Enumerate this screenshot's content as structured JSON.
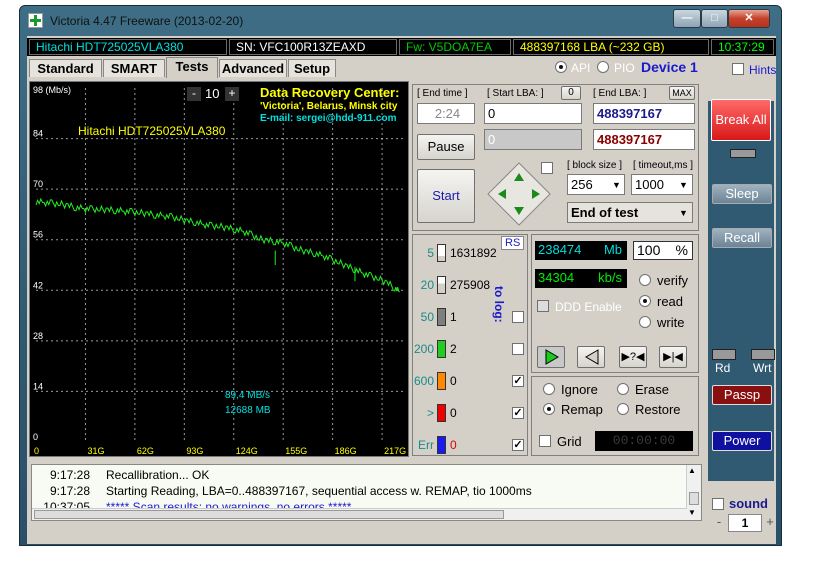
{
  "window": {
    "title": "Victoria 4.47  Freeware (2013-02-20)"
  },
  "info": {
    "model": "Hitachi HDT725025VLA380",
    "serial": "SN: VFC100R13ZEAXD",
    "firmware": "Fw: V5DOA7EA",
    "lba": "488397168 LBA (~232 GB)",
    "time": "10:37:29"
  },
  "tabs": [
    "Standard",
    "SMART",
    "Tests",
    "Advanced",
    "Setup"
  ],
  "mode": {
    "api": "API",
    "pio": "PIO",
    "device": "Device 1",
    "hints": "Hints"
  },
  "graph": {
    "unit": "98 (Mb/s)",
    "counter": "10",
    "counter_minus": "-",
    "counter_plus": "+",
    "drive_label": "Hitachi HDT725025VLA380",
    "drc_title": "Data Recovery Center:",
    "drc_line1": "'Victoria', Belarus, Minsk city",
    "drc_line2": "E-mail: sergei@hdd-911.com",
    "speed": "89,4 MB/s",
    "size": "12688 MB"
  },
  "chart_data": {
    "type": "line",
    "ylabel": "(Mb/s)",
    "y_ticks": [
      "98",
      "84",
      "70",
      "56",
      "42",
      "28",
      "14",
      "0"
    ],
    "x_ticks": [
      "0",
      "31G",
      "62G",
      "93G",
      "124G",
      "155G",
      "186G",
      "217G"
    ],
    "ylim": [
      0,
      98
    ],
    "xlim": [
      0,
      232
    ],
    "series": [
      {
        "x": [
          0,
          5,
          10,
          15,
          20,
          25,
          30,
          35,
          40,
          45,
          50,
          55,
          60,
          65,
          70,
          75,
          80,
          85,
          90,
          95,
          100,
          105,
          110,
          115,
          120,
          125,
          130,
          135,
          140,
          145,
          150,
          155,
          160,
          165,
          170,
          175,
          180,
          185,
          190,
          195,
          200,
          205,
          210,
          215,
          220,
          225,
          228
        ],
        "y": [
          66.5,
          66.3,
          66.1,
          65.9,
          65.5,
          64.9,
          64.6,
          64.5,
          64.4,
          64.3,
          64.1,
          63.9,
          63.7,
          63.5,
          63.2,
          62.8,
          62.6,
          62.3,
          61.8,
          61.2,
          60.8,
          60.2,
          59.9,
          59.7,
          59.3,
          58.8,
          58.3,
          57.4,
          56.3,
          55.8,
          55.5,
          55.1,
          54.2,
          53.3,
          52.7,
          52.2,
          51.5,
          50.6,
          49.7,
          48.7,
          47.7,
          46.7,
          45.9,
          45.2,
          44.1,
          42.7,
          41.5
        ]
      }
    ]
  },
  "controls": {
    "end_time_label": "[ End time ]",
    "end_time": "2:24",
    "start_lba_label": "[ Start LBA: ]",
    "zero": "0",
    "start_lba": "0",
    "end_lba_label": "[ End LBA: ]",
    "max": "MAX",
    "end_lba": "488397167",
    "cur_lba": "0",
    "cur_lba2": "488397167",
    "pause": "Pause",
    "start": "Start",
    "block_label": "[ block size ]",
    "block": "256",
    "timeout_label": "[ timeout,ms ]",
    "timeout": "1000",
    "end_action": "End of test"
  },
  "blocks": {
    "rs": "RS",
    "tolog": "to log:",
    "rows": [
      {
        "label": "5",
        "count": "1631892",
        "color": "#d4d0c8",
        "fill": 0.3
      },
      {
        "label": "20",
        "count": "275908",
        "color": "#d4d0c8",
        "fill": 0.6
      },
      {
        "label": "50",
        "count": "1",
        "color": "#7f7f7f",
        "fill": 1
      },
      {
        "label": "200",
        "count": "2",
        "color": "#22cc22",
        "fill": 1
      },
      {
        "label": "600",
        "count": "0",
        "color": "#ff8800",
        "fill": 1
      },
      {
        "label": ">",
        "count": "0",
        "color": "#ee0000",
        "fill": 1
      },
      {
        "label": "Err",
        "count": "0",
        "color": "#1a1aee",
        "fill": 1
      }
    ]
  },
  "stats": {
    "mb": "238474",
    "mb_unit": "Mb",
    "percent": "100",
    "pct_sign": "%",
    "kbs": "34304",
    "kbs_unit": "kb/s",
    "ddd": "DDD Enable",
    "verify": "verify",
    "read": "read",
    "write": "write"
  },
  "options": {
    "ignore": "Ignore",
    "erase": "Erase",
    "remap": "Remap",
    "restore": "Restore",
    "grid": "Grid",
    "timer": "00:00:00"
  },
  "side": {
    "break_all": "Break All",
    "sleep": "Sleep",
    "recall": "Recall",
    "rd": "Rd",
    "wrt": "Wrt",
    "passp": "Passp",
    "power": "Power",
    "sound": "sound",
    "sound_val": "1",
    "minus": "-",
    "plus": "+"
  },
  "log": [
    {
      "time": "9:17:28",
      "text": "Recallibration... OK",
      "color": "#000000"
    },
    {
      "time": "9:17:28",
      "text": "Starting Reading, LBA=0..488397167, sequential access w. REMAP, tio 1000ms",
      "color": "#000000"
    },
    {
      "time": "10:37:05",
      "text": "***** Scan results: no warnings, no errors *****",
      "color": "#1a1acc"
    }
  ]
}
